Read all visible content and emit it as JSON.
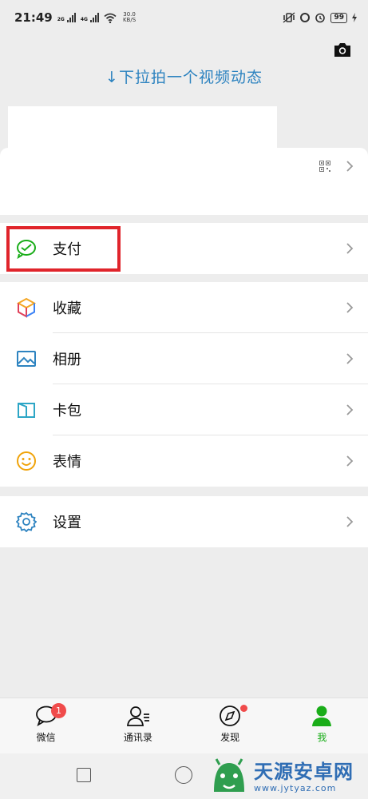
{
  "status": {
    "time": "21:49",
    "net_2g": "2G",
    "net_4g": "4G",
    "speed_value": "30.0",
    "speed_unit": "KB/S",
    "battery": "99"
  },
  "header": {
    "pull_hint": "↓下拉拍一个视频动态"
  },
  "menu": {
    "pay": "支付",
    "favorites": "收藏",
    "album": "相册",
    "cards": "卡包",
    "stickers": "表情",
    "settings": "设置"
  },
  "tabs": {
    "chats": {
      "label": "微信",
      "badge": "1"
    },
    "contacts": {
      "label": "通讯录"
    },
    "discover": {
      "label": "发现"
    },
    "me": {
      "label": "我"
    }
  },
  "watermark": {
    "title": "天源安卓网",
    "url": "www.jytyaz.com"
  },
  "colors": {
    "accent_green": "#1aad19",
    "link_blue": "#2d83c0",
    "highlight_red": "#e0242b",
    "badge_red": "#f04b4b"
  }
}
